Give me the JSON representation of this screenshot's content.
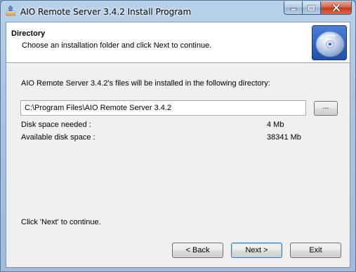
{
  "window": {
    "title": "AIO Remote Server 3.4.2 Install Program"
  },
  "header": {
    "title": "Directory",
    "subtitle": "Choose an installation folder and click Next to continue."
  },
  "main": {
    "info": "AIO Remote Server 3.4.2's files will be installed in the following directory:",
    "path_value": "C:\\Program Files\\AIO Remote Server 3.4.2",
    "browse_label": "...",
    "disk_needed_label": "Disk space needed :",
    "disk_needed_value": "4 Mb",
    "disk_available_label": "Available disk space :",
    "disk_available_value": "38341 Mb",
    "footer_hint": "Click 'Next' to continue."
  },
  "buttons": {
    "back": "< Back",
    "next": "Next >",
    "exit": "Exit"
  },
  "colors": {
    "title_bar": "#b9d1ea",
    "close_button": "#c3391a",
    "dialog_bg": "#f0f0f0"
  }
}
